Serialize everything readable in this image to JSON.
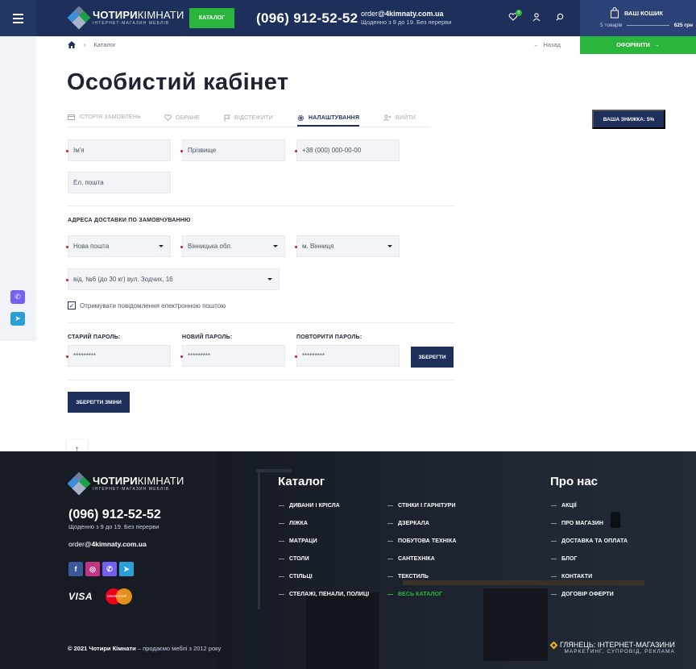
{
  "header": {
    "logo_title_bold": "ЧОТИРИ",
    "logo_title_rest": "КІМНАТИ",
    "logo_subtitle": "ІНТЕРНЕТ-МАГАЗИН МЕБЛІВ",
    "catalog_button": "КАТАЛОГ",
    "phone": "(096) 912-52-52",
    "email_prefix": "order@",
    "email_domain": "4kimnaty.com.ua",
    "hours": "Щоденно з 9 до 19. Без перерви",
    "wishlist_count": "0",
    "cart_title": "ВАШ КОШИК",
    "cart_items": "5 товарів",
    "cart_total": "625 грн",
    "order_button": "ОФОРМИТИ"
  },
  "breadcrumb": {
    "current": "Каталог",
    "back": "Назад"
  },
  "page_title": "Особистий кабінет",
  "tabs": [
    {
      "label": "ІСТОРІЯ ЗАМОВЛЕНЬ"
    },
    {
      "label": "ОБРАНЕ"
    },
    {
      "label": "ВІДСТЕЖИТИ"
    },
    {
      "label": "НАЛАШТУВАННЯ"
    },
    {
      "label": "ВИЙТИ"
    }
  ],
  "discount_button": "ВАША ЗНИЖКА: 5%",
  "form": {
    "first_name": "Ім'я",
    "last_name": "Прізвище",
    "phone": "+38 (000) 000-00-00",
    "email": "Ел. пошта",
    "delivery_title": "АДРЕСА ДОСТАВКИ ПО ЗАМОВЧУВАННЮ",
    "carrier": "Нова пошта",
    "region": "Вінницька обл.",
    "city": "м. Вінниця",
    "branch": "від. №6 (до 30 кг) вул. Зодчих, 16",
    "newsletter_label": "Отримувати повідомлення електронною поштою",
    "old_password_label": "СТАРИЙ ПАРОЛЬ:",
    "new_password_label": "НОВИЙ ПАРОЛЬ:",
    "repeat_password_label": "ПОВТОРИТИ ПАРОЛЬ:",
    "old_password": "*********",
    "new_password": "*********",
    "repeat_password": "*********",
    "save_password_button": "ЗБЕРЕГТИ",
    "save_changes_button": "ЗБЕРЕГТИ ЗМІНИ"
  },
  "footer": {
    "phone": "(096) 912-52-52",
    "hours": "Щоденно з 9 до 19. Без перерви",
    "email_prefix": "order@",
    "email_domain": "4kimnaty.com.ua",
    "visa": "VISA",
    "mastercard": "MasterCard",
    "catalog_heading": "Каталог",
    "catalog_col1": [
      "ДИВАНИ І КРІСЛА",
      "ЛІЖКА",
      "МАТРАЦИ",
      "СТОЛИ",
      "СТІЛЬЦІ",
      "СТЕЛАЖІ, ПЕНАЛИ, ПОЛИЦІ"
    ],
    "catalog_col2": [
      "СТІНКИ І ГАРНІТУРИ",
      "ДЗЕРКАЛА",
      "ПОБУТОВА ТЕХНІКА",
      "САНТЕХНІКА",
      "ТЕКСТИЛЬ",
      "ВЕСЬ КАТАЛОГ"
    ],
    "about_heading": "Про нас",
    "about_links": [
      "АКЦІЇ",
      "ПРО МАГАЗИН",
      "ДОСТАВКА ТА ОПЛАТА",
      "БЛОГ",
      "КОНТАКТИ",
      "ДОГОВІР ОФЕРТИ"
    ],
    "copyright_bold": "© 2021 Чотири Кімнати",
    "copyright_rest": " – продаємо меблі з 2012 року",
    "dev_title": "ГЛЯНЕЦЬ: ІНТЕРНЕТ-МАГАЗИНИ",
    "dev_sub": "МАРКЕТИНГ, СУПРОВІД, РЕКЛАМА"
  },
  "colors": {
    "navy": "#1d2f5a",
    "green": "#2ab53c",
    "required": "#d0182f",
    "footer_bg": "#171b24"
  }
}
